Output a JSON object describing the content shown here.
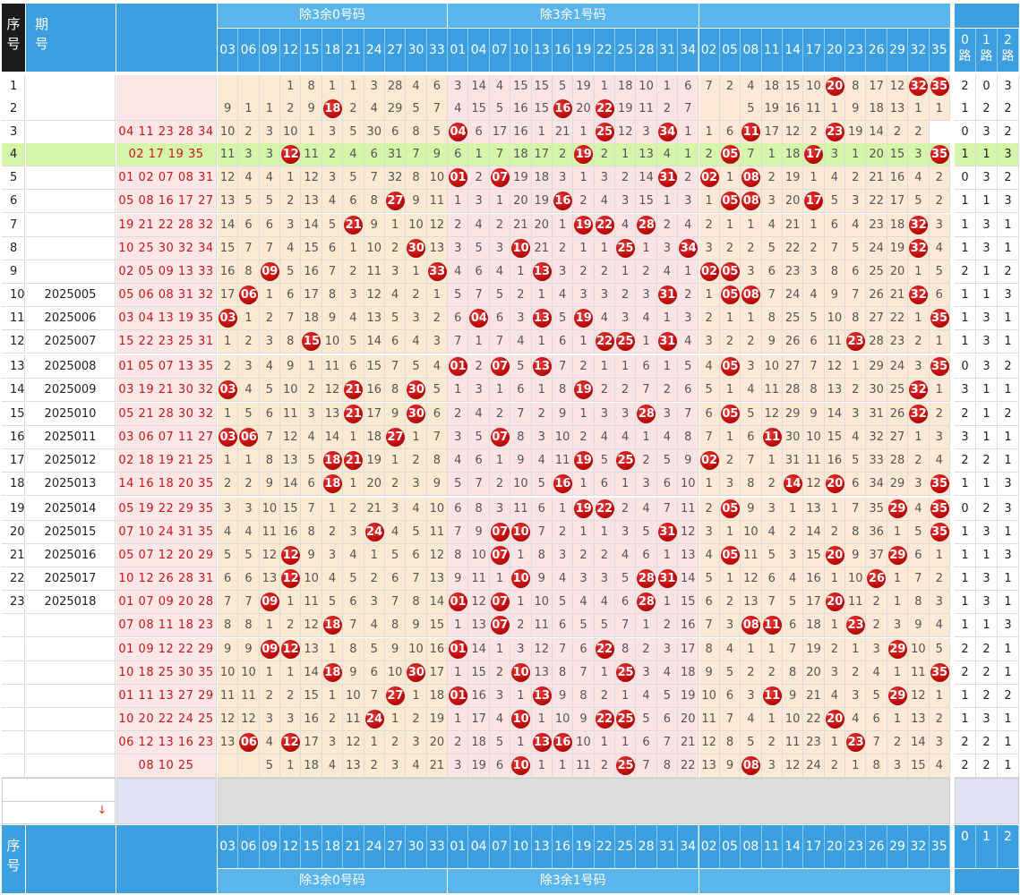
{
  "header": {
    "seq_label": [
      "序",
      "号"
    ],
    "period_label": [
      "期",
      "号"
    ],
    "group_labels": [
      "除3余0号码",
      "除3余1号码"
    ],
    "route_labels": [
      "0路",
      "1路",
      "2路"
    ],
    "route_short": [
      "0",
      "1",
      "2"
    ]
  },
  "columns": {
    "r0": [
      "03",
      "06",
      "09",
      "12",
      "15",
      "18",
      "21",
      "24",
      "27",
      "30",
      "33"
    ],
    "r1": [
      "01",
      "04",
      "07",
      "10",
      "13",
      "16",
      "19",
      "22",
      "25",
      "28",
      "31",
      "34"
    ],
    "r2": [
      "02",
      "05",
      "08",
      "11",
      "14",
      "17",
      "20",
      "23",
      "26",
      "29",
      "32",
      "35"
    ]
  },
  "rows": [
    {
      "seq": "1",
      "period": "",
      "draw": "",
      "cells": [
        null,
        null,
        null,
        1,
        8,
        1,
        1,
        3,
        28,
        4,
        6,
        3,
        14,
        4,
        15,
        15,
        5,
        19,
        1,
        18,
        10,
        1,
        6,
        7,
        2,
        4,
        18,
        15,
        10,
        "20",
        8,
        17,
        12,
        "32",
        "35"
      ],
      "routes": [
        2,
        0,
        3
      ]
    },
    {
      "seq": "2",
      "period": "",
      "draw": "",
      "cells": [
        9,
        1,
        1,
        2,
        9,
        "18",
        2,
        4,
        29,
        5,
        7,
        4,
        15,
        5,
        16,
        15,
        "16",
        20,
        "22",
        19,
        11,
        2,
        7,
        null,
        null,
        5,
        19,
        16,
        11,
        1,
        9,
        18,
        13,
        1,
        1
      ],
      "routes": [
        1,
        2,
        2
      ]
    },
    {
      "seq": "3",
      "period": "",
      "draw": "04 11 23 28 34",
      "cells": [
        10,
        2,
        3,
        10,
        1,
        3,
        5,
        30,
        6,
        8,
        5,
        "04",
        6,
        17,
        16,
        1,
        21,
        1,
        "25",
        12,
        3,
        "34",
        1,
        1,
        6,
        "11",
        17,
        12,
        2,
        "23",
        19,
        14,
        2,
        2
      ],
      "routes": [
        0,
        3,
        2
      ]
    },
    {
      "seq": "4",
      "period": "",
      "draw": "02 17 19 35",
      "cells": [
        11,
        3,
        3,
        "12",
        11,
        2,
        4,
        6,
        31,
        7,
        9,
        6,
        1,
        7,
        18,
        17,
        2,
        "19",
        2,
        1,
        13,
        4,
        1,
        2,
        "05",
        7,
        1,
        18,
        "17",
        3,
        1,
        20,
        15,
        3,
        "35"
      ],
      "routes": [
        1,
        1,
        3
      ]
    },
    {
      "seq": "5",
      "period": "",
      "draw": "01 02 07 08 31",
      "cells": [
        12,
        4,
        4,
        1,
        12,
        3,
        5,
        7,
        32,
        8,
        10,
        "01",
        2,
        "07",
        19,
        18,
        3,
        1,
        3,
        2,
        14,
        "31",
        2,
        "02",
        1,
        "08",
        2,
        19,
        1,
        4,
        2,
        21,
        16,
        4,
        2
      ],
      "routes": [
        0,
        3,
        2
      ]
    },
    {
      "seq": "6",
      "period": "",
      "draw": "05 08 16 17 27",
      "cells": [
        13,
        5,
        5,
        2,
        13,
        4,
        6,
        8,
        "27",
        9,
        11,
        1,
        3,
        1,
        20,
        19,
        "16",
        2,
        4,
        3,
        15,
        1,
        3,
        1,
        "05",
        "08",
        3,
        20,
        "17",
        5,
        3,
        22,
        17,
        5,
        2
      ],
      "routes": [
        1,
        1,
        3
      ]
    },
    {
      "seq": "7",
      "period": "",
      "draw": "19 21 22 28 32",
      "cells": [
        14,
        6,
        6,
        3,
        14,
        5,
        "21",
        9,
        1,
        10,
        12,
        2,
        4,
        2,
        21,
        20,
        1,
        "19",
        "22",
        4,
        "28",
        2,
        4,
        2,
        1,
        1,
        4,
        21,
        1,
        6,
        4,
        23,
        18,
        "32",
        3
      ],
      "routes": [
        1,
        3,
        1
      ]
    },
    {
      "seq": "8",
      "period": "",
      "draw": "10 25 30 32 34",
      "cells": [
        15,
        7,
        7,
        4,
        15,
        6,
        1,
        10,
        2,
        "30",
        13,
        3,
        5,
        3,
        "10",
        21,
        2,
        1,
        1,
        "25",
        1,
        3,
        "34",
        3,
        2,
        2,
        5,
        22,
        2,
        7,
        5,
        24,
        19,
        "32",
        4
      ],
      "routes": [
        1,
        3,
        1
      ]
    },
    {
      "seq": "9",
      "period": "",
      "draw": "02 05 09 13 33",
      "cells": [
        16,
        8,
        "09",
        5,
        16,
        7,
        2,
        11,
        3,
        1,
        "33",
        4,
        6,
        4,
        1,
        "13",
        3,
        2,
        2,
        1,
        2,
        4,
        1,
        "02",
        "05",
        3,
        6,
        23,
        3,
        8,
        6,
        25,
        20,
        1,
        5
      ],
      "routes": [
        2,
        1,
        2
      ]
    },
    {
      "seq": "10",
      "period": "2025005",
      "draw": "05 06 08 31 32",
      "cells": [
        17,
        "06",
        1,
        6,
        17,
        8,
        3,
        12,
        4,
        2,
        1,
        5,
        7,
        5,
        2,
        1,
        4,
        3,
        3,
        2,
        3,
        "31",
        2,
        1,
        "05",
        "08",
        7,
        24,
        4,
        9,
        7,
        26,
        21,
        "32",
        6
      ],
      "routes": [
        1,
        1,
        3
      ]
    },
    {
      "seq": "11",
      "period": "2025006",
      "draw": "03 04 13 19 35",
      "cells": [
        "03",
        1,
        2,
        7,
        18,
        9,
        4,
        13,
        5,
        3,
        2,
        6,
        "04",
        6,
        3,
        "13",
        5,
        "19",
        4,
        3,
        4,
        1,
        3,
        2,
        1,
        1,
        8,
        25,
        5,
        10,
        8,
        27,
        22,
        1,
        "35"
      ],
      "routes": [
        1,
        3,
        1
      ]
    },
    {
      "seq": "12",
      "period": "2025007",
      "draw": "15 22 23 25 31",
      "cells": [
        1,
        2,
        3,
        8,
        "15",
        10,
        5,
        14,
        6,
        4,
        3,
        7,
        1,
        7,
        4,
        1,
        6,
        1,
        "22",
        "25",
        1,
        "31",
        4,
        3,
        2,
        2,
        9,
        26,
        6,
        11,
        "23",
        28,
        23,
        2,
        1
      ],
      "routes": [
        1,
        3,
        1
      ]
    },
    {
      "seq": "13",
      "period": "2025008",
      "draw": "01 05 07 13 35",
      "cells": [
        2,
        3,
        4,
        9,
        1,
        11,
        6,
        15,
        7,
        5,
        4,
        "01",
        2,
        "07",
        5,
        "13",
        7,
        2,
        1,
        1,
        6,
        1,
        5,
        4,
        "05",
        3,
        10,
        27,
        7,
        12,
        1,
        29,
        24,
        3,
        "35"
      ],
      "routes": [
        0,
        3,
        2
      ]
    },
    {
      "seq": "14",
      "period": "2025009",
      "draw": "03 19 21 30 32",
      "cells": [
        "03",
        4,
        5,
        10,
        2,
        12,
        "21",
        16,
        8,
        "30",
        5,
        1,
        3,
        1,
        6,
        1,
        8,
        "19",
        2,
        2,
        7,
        2,
        6,
        5,
        1,
        4,
        11,
        28,
        8,
        13,
        2,
        30,
        25,
        "32",
        1
      ],
      "routes": [
        3,
        1,
        1
      ]
    },
    {
      "seq": "15",
      "period": "2025010",
      "draw": "05 21 28 30 32",
      "cells": [
        1,
        5,
        6,
        11,
        3,
        13,
        "21",
        17,
        9,
        "30",
        6,
        2,
        4,
        2,
        7,
        2,
        9,
        1,
        3,
        3,
        "28",
        3,
        7,
        6,
        "05",
        5,
        12,
        29,
        9,
        14,
        3,
        31,
        26,
        "32",
        2
      ],
      "routes": [
        2,
        1,
        2
      ]
    },
    {
      "seq": "16",
      "period": "2025011",
      "draw": "03 06 07 11 27",
      "cells": [
        "03",
        "06",
        7,
        12,
        4,
        14,
        1,
        18,
        "27",
        1,
        7,
        3,
        5,
        "07",
        8,
        3,
        10,
        2,
        4,
        4,
        1,
        4,
        8,
        7,
        1,
        6,
        "11",
        30,
        10,
        15,
        4,
        32,
        27,
        1,
        3
      ],
      "routes": [
        3,
        1,
        1
      ]
    },
    {
      "seq": "17",
      "period": "2025012",
      "draw": "02 18 19 21 25",
      "cells": [
        1,
        1,
        8,
        13,
        5,
        "18",
        "21",
        19,
        1,
        2,
        8,
        4,
        6,
        1,
        9,
        4,
        11,
        "19",
        5,
        "25",
        2,
        5,
        9,
        "02",
        2,
        7,
        1,
        31,
        11,
        16,
        5,
        33,
        28,
        2,
        4
      ],
      "routes": [
        2,
        2,
        1
      ]
    },
    {
      "seq": "18",
      "period": "2025013",
      "draw": "14 16 18 20 35",
      "cells": [
        2,
        2,
        9,
        14,
        6,
        "18",
        1,
        20,
        2,
        3,
        9,
        5,
        7,
        2,
        10,
        5,
        "16",
        1,
        6,
        1,
        3,
        6,
        10,
        1,
        3,
        8,
        2,
        "14",
        12,
        "20",
        6,
        34,
        29,
        3,
        "35"
      ],
      "routes": [
        1,
        1,
        3
      ]
    },
    {
      "seq": "19",
      "period": "2025014",
      "draw": "05 19 22 29 35",
      "cells": [
        3,
        3,
        10,
        15,
        7,
        1,
        2,
        21,
        3,
        4,
        10,
        6,
        8,
        3,
        11,
        6,
        1,
        "19",
        "22",
        2,
        4,
        7,
        11,
        2,
        "05",
        9,
        3,
        1,
        13,
        1,
        7,
        35,
        "29",
        4,
        "35"
      ],
      "routes": [
        0,
        2,
        3
      ]
    },
    {
      "seq": "20",
      "period": "2025015",
      "draw": "07 10 24 31 35",
      "cells": [
        4,
        4,
        11,
        16,
        8,
        2,
        3,
        "24",
        4,
        5,
        11,
        7,
        9,
        "07",
        "10",
        7,
        2,
        1,
        1,
        3,
        5,
        "31",
        12,
        3,
        1,
        10,
        4,
        2,
        14,
        2,
        8,
        36,
        1,
        5,
        "35"
      ],
      "routes": [
        1,
        3,
        1
      ]
    },
    {
      "seq": "21",
      "period": "2025016",
      "draw": "05 07 12 20 29",
      "cells": [
        5,
        5,
        12,
        "12",
        9,
        3,
        4,
        1,
        5,
        6,
        12,
        8,
        10,
        "07",
        1,
        8,
        3,
        2,
        2,
        4,
        6,
        1,
        13,
        4,
        "05",
        11,
        5,
        3,
        15,
        "20",
        9,
        37,
        "29",
        6,
        1
      ],
      "routes": [
        1,
        1,
        3
      ]
    },
    {
      "seq": "22",
      "period": "2025017",
      "draw": "10 12 26 28 31",
      "cells": [
        6,
        6,
        13,
        "12",
        10,
        4,
        5,
        2,
        6,
        7,
        13,
        9,
        11,
        1,
        "10",
        9,
        4,
        3,
        3,
        5,
        "28",
        "31",
        14,
        5,
        1,
        12,
        6,
        4,
        16,
        1,
        10,
        "26",
        1,
        7,
        2
      ],
      "routes": [
        1,
        3,
        1
      ]
    },
    {
      "seq": "23",
      "period": "2025018",
      "draw": "01 07 09 20 28",
      "cells": [
        7,
        7,
        "09",
        1,
        11,
        5,
        6,
        3,
        7,
        8,
        14,
        "01",
        12,
        "07",
        1,
        10,
        5,
        4,
        4,
        6,
        "28",
        1,
        15,
        6,
        2,
        13,
        7,
        5,
        17,
        "20",
        11,
        2,
        1,
        8,
        3
      ],
      "routes": [
        1,
        3,
        1
      ]
    },
    {
      "seq": "",
      "period": "",
      "draw": "07 08 11 18 23",
      "cells": [
        8,
        8,
        1,
        2,
        12,
        "18",
        7,
        4,
        8,
        9,
        15,
        1,
        13,
        "07",
        2,
        11,
        6,
        5,
        5,
        7,
        1,
        2,
        16,
        7,
        3,
        "08",
        "11",
        6,
        18,
        1,
        "23",
        2,
        3,
        9,
        4
      ],
      "routes": [
        1,
        1,
        3
      ]
    },
    {
      "seq": "",
      "period": "",
      "draw": "01 09 12 22 29",
      "cells": [
        9,
        9,
        "09",
        "12",
        13,
        1,
        8,
        5,
        9,
        10,
        16,
        "01",
        14,
        1,
        3,
        12,
        7,
        6,
        "22",
        8,
        2,
        3,
        17,
        8,
        4,
        1,
        1,
        7,
        19,
        2,
        1,
        3,
        "29",
        10,
        5
      ],
      "routes": [
        2,
        2,
        1
      ]
    },
    {
      "seq": "",
      "period": "",
      "draw": "10 18 25 30 35",
      "cells": [
        10,
        10,
        1,
        1,
        14,
        "18",
        9,
        6,
        10,
        "30",
        17,
        1,
        15,
        2,
        "10",
        13,
        8,
        7,
        1,
        "25",
        3,
        4,
        18,
        9,
        5,
        2,
        2,
        8,
        20,
        3,
        2,
        4,
        1,
        11,
        "35"
      ],
      "routes": [
        2,
        2,
        1
      ]
    },
    {
      "seq": "",
      "period": "",
      "draw": "01 11 13 27 29",
      "cells": [
        11,
        11,
        2,
        2,
        15,
        1,
        10,
        7,
        "27",
        1,
        18,
        "01",
        16,
        3,
        1,
        "13",
        9,
        8,
        2,
        1,
        4,
        5,
        19,
        10,
        6,
        3,
        "11",
        9,
        21,
        4,
        3,
        5,
        "29",
        12,
        1
      ],
      "routes": [
        1,
        2,
        2
      ]
    },
    {
      "seq": "",
      "period": "",
      "draw": "10 20 22 24 25",
      "cells": [
        12,
        12,
        3,
        3,
        16,
        2,
        11,
        "24",
        1,
        2,
        19,
        1,
        17,
        4,
        "10",
        1,
        10,
        9,
        "22",
        "25",
        5,
        6,
        20,
        11,
        7,
        4,
        1,
        10,
        22,
        "20",
        4,
        6,
        1,
        13,
        2
      ],
      "routes": [
        1,
        3,
        1
      ]
    },
    {
      "seq": "",
      "period": "",
      "draw": "06 12 13 16 23",
      "cells": [
        13,
        "06",
        4,
        "12",
        17,
        3,
        12,
        1,
        2,
        3,
        20,
        2,
        18,
        5,
        1,
        "13",
        "16",
        10,
        1,
        1,
        6,
        7,
        21,
        12,
        8,
        5,
        2,
        11,
        23,
        1,
        "23",
        7,
        2,
        14,
        3
      ],
      "routes": [
        2,
        2,
        1
      ]
    },
    {
      "seq": "",
      "period": "",
      "draw": "08 10 25",
      "cells": [
        null,
        null,
        5,
        1,
        18,
        4,
        13,
        2,
        3,
        4,
        21,
        3,
        19,
        6,
        "10",
        1,
        1,
        11,
        2,
        "25",
        7,
        8,
        22,
        13,
        9,
        "08",
        3,
        12,
        24,
        2,
        1,
        8,
        3,
        15,
        4
      ],
      "routes": [
        2,
        2,
        1
      ]
    }
  ],
  "footer": {
    "route_short": [
      "0",
      "1",
      "2"
    ],
    "scroll_icon": "down-arrow-icon"
  }
}
